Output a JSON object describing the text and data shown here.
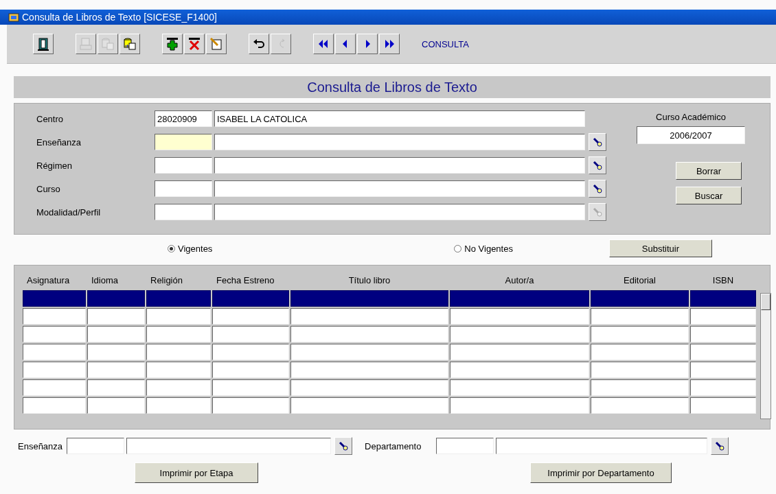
{
  "window": {
    "title": "Consulta de Libros de Texto [SICESE_F1400]"
  },
  "toolbar": {
    "groups": [
      [
        {
          "kind": "exit",
          "disabled": false
        }
      ],
      [
        {
          "kind": "print",
          "disabled": true
        },
        {
          "kind": "db",
          "disabled": true
        },
        {
          "kind": "db-arrow",
          "disabled": false
        }
      ],
      [
        {
          "kind": "add",
          "disabled": false
        },
        {
          "kind": "delete",
          "disabled": false
        },
        {
          "kind": "edit",
          "disabled": false
        }
      ],
      [
        {
          "kind": "undo",
          "disabled": false
        },
        {
          "kind": "redo",
          "disabled": true
        }
      ],
      [
        {
          "kind": "first",
          "disabled": false
        },
        {
          "kind": "prev",
          "disabled": false
        },
        {
          "kind": "next",
          "disabled": false
        },
        {
          "kind": "last",
          "disabled": false
        }
      ]
    ],
    "mode": "CONSULTA"
  },
  "header": {
    "title": "Consulta de Libros de Texto"
  },
  "form": {
    "fields": [
      {
        "label": "Centro",
        "code": "28020909",
        "description": "ISABEL LA CATOLICA",
        "focused": false
      },
      {
        "label": "Enseñanza",
        "focused": true,
        "lookup": {
          "disabled": false
        }
      },
      {
        "label": "Régimen",
        "focused": false,
        "lookup": {
          "disabled": false
        }
      },
      {
        "label": "Curso",
        "focused": false,
        "lookup": {
          "disabled": false
        }
      },
      {
        "label": "Modalidad/Perfil",
        "focused": false,
        "lookup": {
          "disabled": true
        }
      }
    ],
    "academic_year": {
      "label": "Curso Académico",
      "value": "2006/2007"
    },
    "buttons": [
      "Borrar",
      "Buscar"
    ]
  },
  "filter": {
    "radios": [
      {
        "label": "Vigentes",
        "selected": true
      },
      {
        "label": "No Vigentes",
        "selected": false
      }
    ],
    "button": "Substituir"
  },
  "table": {
    "columns": [
      "Asignatura",
      "Idioma",
      "Religión",
      "Fecha Estreno",
      "Título libro",
      "Autor/a",
      "Editorial",
      "ISBN"
    ],
    "rows": [
      {
        "selected": true
      },
      {
        "selected": false
      },
      {
        "selected": false
      },
      {
        "selected": false
      },
      {
        "selected": false
      },
      {
        "selected": false
      },
      {
        "selected": false
      }
    ]
  },
  "bottom": {
    "filters": [
      {
        "label": "Enseñanza"
      },
      {
        "label": "Departamento"
      }
    ],
    "buttons": [
      "Imprimir por Etapa",
      "Imprimir por Departamento"
    ]
  }
}
